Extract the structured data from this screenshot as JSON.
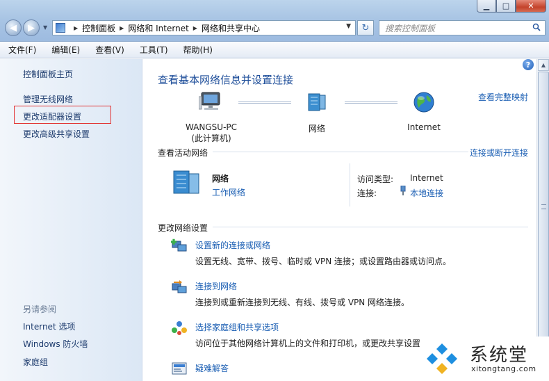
{
  "window": {
    "controls": {
      "minimize": "▁",
      "maximize": "□",
      "close": "✕"
    }
  },
  "address_bar": {
    "crumbs": [
      "控制面板",
      "网络和 Internet",
      "网络和共享中心"
    ],
    "search_placeholder": "搜索控制面板"
  },
  "menubar": {
    "items": [
      "文件(F)",
      "编辑(E)",
      "查看(V)",
      "工具(T)",
      "帮助(H)"
    ]
  },
  "sidebar": {
    "home": "控制面板主页",
    "wireless": "管理无线网络",
    "adapter": "更改适配器设置",
    "advanced": "更改高级共享设置",
    "see_also": "另请参阅",
    "internet_options": "Internet 选项",
    "firewall": "Windows 防火墙",
    "homegroup": "家庭组"
  },
  "main": {
    "title": "查看基本网络信息并设置连接",
    "full_map": "查看完整映射",
    "map": {
      "pc_name": "WANGSU-PC",
      "pc_sub": "(此计算机)",
      "network": "网络",
      "internet": "Internet"
    },
    "active_header": "查看活动网络",
    "connect_link": "连接或断开连接",
    "active": {
      "name": "网络",
      "type": "工作网络",
      "access_label": "访问类型:",
      "access_value": "Internet",
      "conn_label": "连接:",
      "conn_value": "本地连接"
    },
    "change_header": "更改网络设置",
    "tasks": [
      {
        "link": "设置新的连接或网络",
        "desc": "设置无线、宽带、拨号、临时或 VPN 连接；或设置路由器或访问点。"
      },
      {
        "link": "连接到网络",
        "desc": "连接到或重新连接到无线、有线、拨号或 VPN 网络连接。"
      },
      {
        "link": "选择家庭组和共享选项",
        "desc": "访问位于其他网络计算机上的文件和打印机，或更改共享设置。"
      },
      {
        "link": "疑难解答",
        "desc": ""
      }
    ]
  },
  "watermark": {
    "text": "系统堂",
    "url": "xitongtang.com"
  }
}
